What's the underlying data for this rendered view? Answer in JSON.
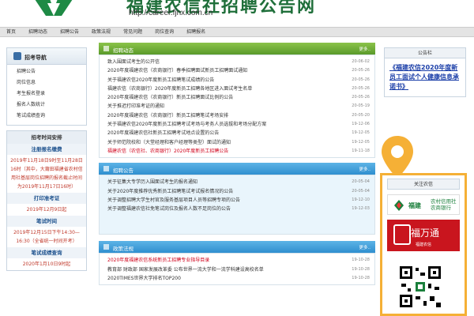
{
  "header": {
    "title": "福建农信社招聘公告网",
    "url": "http://career.fjnx.com.cn"
  },
  "nav": [
    "首页",
    "招聘动态",
    "招聘公告",
    "政策法规",
    "常见问题",
    "岗位查询",
    "招聘报名"
  ],
  "left": {
    "nav_title": "招考导航",
    "nav_items": [
      "招聘公告",
      "岗位信息",
      "考生报名登录",
      "报名人数统计",
      "笔试成绩查询"
    ],
    "schedule_title": "招考时间安排",
    "schedule": [
      {
        "head": "注册报名缴费",
        "body": "2019年11月18日9时至11月28日16时（其中，大莆田福建省农村信用社基层岗位招聘的报名截止时间为2019年11月17日16时）"
      },
      {
        "head": "打印准考证",
        "body": "2019年12月9日起"
      },
      {
        "head": "笔试时间",
        "body": "2019年12月15日下午14:30—16:30（全省统一时间开考）"
      },
      {
        "head": "笔试成绩查询",
        "body": "2020年1月10日9时起"
      }
    ]
  },
  "panels": [
    {
      "title": "招聘动态",
      "more": "更多..",
      "color": "green",
      "items": [
        {
          "text": "致入围面试考生的公开信",
          "date": "20-06-02",
          "red": false
        },
        {
          "text": "2020年度福建农信（农商银行）春季招聘面试新员工招聘面试通知",
          "date": "20-05-26",
          "red": false
        },
        {
          "text": "关于福建农信2020年度新员工招聘笔试成绩的公告",
          "date": "20-05-26",
          "red": false
        },
        {
          "text": "福建农信（农商银行）2020年度新员工招聘各地区进入面试考生名单",
          "date": "20-05-26",
          "red": false
        },
        {
          "text": "2020年度福建农信（农商银行）新员工招聘面试比例的公告",
          "date": "20-05-26",
          "red": false
        },
        {
          "text": "关于推迟打印准考证的通知",
          "date": "20-05-19",
          "red": false
        },
        {
          "text": "2020年度福建农信（农商银行）新员工招聘笔试考场安排",
          "date": "20-05-20",
          "red": false
        },
        {
          "text": "关于福建农信2020年度新员工招聘考试考场与考务人员选拔和考场分配方案",
          "date": "19-12-06",
          "red": false
        },
        {
          "text": "2020年度福建农信社新员工招聘考试地点设置的公告",
          "date": "19-12-05",
          "red": false
        },
        {
          "text": "关于师范院校和（大堂经理和客户经理等类型）面试的通知",
          "date": "19-12-05",
          "red": false
        },
        {
          "text": "福建农信（农信社、农商银行）2020年度新员工招聘公告",
          "date": "19-11-18",
          "red": true
        }
      ]
    },
    {
      "title": "招聘公告",
      "more": "更多..",
      "color": "blue",
      "items": [
        {
          "text": "关于征集大专学历入围面试考生的报名通知",
          "date": "20-05-04",
          "red": false
        },
        {
          "text": "关于2020年度推荐优秀新员工招聘笔试考试报名情况的公告",
          "date": "20-05-04",
          "red": false
        },
        {
          "text": "关于调整招聘大学生村官及服务基层项目人员等招聘专项的公告",
          "date": "19-12-10",
          "red": false
        },
        {
          "text": "关于调整福建农信社免笔试岗位及报名人数不足岗位的公告",
          "date": "19-12-03",
          "red": false
        }
      ]
    },
    {
      "title": "政策法规",
      "more": "更多..",
      "color": "blue",
      "items": [
        {
          "text": "2020年度福建农信系统新员工招聘专业指导目录",
          "date": "19-10-28",
          "red": true
        },
        {
          "text": "教育部 财政部 国家发展改革委 公布世界一流大学和一流学科建设高校名单",
          "date": "19-10-28",
          "red": false
        },
        {
          "text": "2020TIMES世界大学排名TOP200",
          "date": "19-10-28",
          "red": false
        }
      ]
    }
  ],
  "right": {
    "notice_title": "公告栏",
    "notice_link": "《福建农信2020年度新员工面试个人健康信息承诺书》",
    "org_title": "关注农信",
    "bank_name": "福建",
    "bank_sub": "农村信用社\n农商银行",
    "fwt_text": "福万通",
    "fwt_sub": "福建农信"
  }
}
